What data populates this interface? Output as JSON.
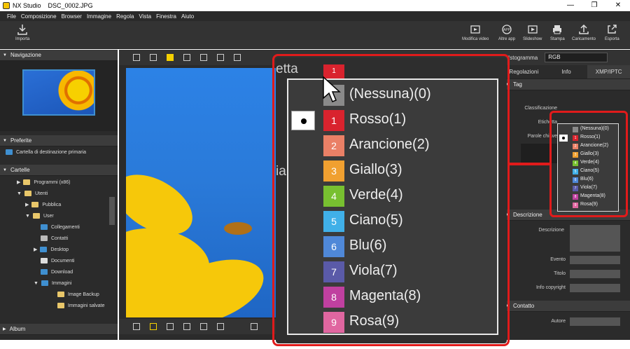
{
  "window": {
    "app": "NX Studio",
    "file": "DSC_0002.JPG",
    "controls": [
      "—",
      "❐",
      "✕"
    ]
  },
  "menu": [
    "File",
    "Composizione",
    "Browser",
    "Immagine",
    "Regola",
    "Vista",
    "Finestra",
    "Aiuto"
  ],
  "toolbar": {
    "import": "Importa",
    "items": [
      "Modifica video",
      "Altre app",
      "Slideshow",
      "Stampa",
      "Caricamento",
      "Esporta"
    ]
  },
  "left": {
    "navigation": "Navigazione",
    "favorites": "Preferite",
    "favorites_item": "Cartella di destinazione primaria",
    "folders": "Cartelle",
    "tree": [
      "Programmi (x86)",
      "Utenti",
      "Pubblica",
      "User",
      "Collegamenti",
      "Contatti",
      "Desktop",
      "Documenti",
      "Download",
      "Immagini",
      "Image Backup",
      "Immagini salvate"
    ],
    "album": "Album"
  },
  "right": {
    "histogram": "Istogramma",
    "histogram_mode": "RGB",
    "tabs": [
      "Regolazioni",
      "Info",
      "XMP/IPTC"
    ],
    "tag_section": "Tag",
    "rating_label": "Classificazione",
    "label_label": "Etichetta",
    "keywords_label": "Parole chiave",
    "description_section": "Descrizione",
    "description_label": "Descrizione",
    "event_label": "Evento",
    "title_label": "Titolo",
    "copyright_label": "Info copyright",
    "contact_section": "Contatto",
    "author_label": "Autore"
  },
  "zoom": {
    "label_fragment_top": "etta",
    "label_fragment_side": "ia",
    "current_chip": "1"
  },
  "label_menu": {
    "items": [
      {
        "num": "",
        "text": "(Nessuna)(0)",
        "color": "#8a8a8a"
      },
      {
        "num": "1",
        "text": "Rosso(1)",
        "color": "#d9232e"
      },
      {
        "num": "2",
        "text": "Arancione(2)",
        "color": "#ea8066"
      },
      {
        "num": "3",
        "text": "Giallo(3)",
        "color": "#f0a030"
      },
      {
        "num": "4",
        "text": "Verde(4)",
        "color": "#78c030"
      },
      {
        "num": "5",
        "text": "Ciano(5)",
        "color": "#40b0e8"
      },
      {
        "num": "6",
        "text": "Blu(6)",
        "color": "#4f88d8"
      },
      {
        "num": "7",
        "text": "Viola(7)",
        "color": "#5a5aa8"
      },
      {
        "num": "8",
        "text": "Magenta(8)",
        "color": "#c040a0"
      },
      {
        "num": "9",
        "text": "Rosa(9)",
        "color": "#e066a0"
      }
    ],
    "selected_index": 1
  }
}
